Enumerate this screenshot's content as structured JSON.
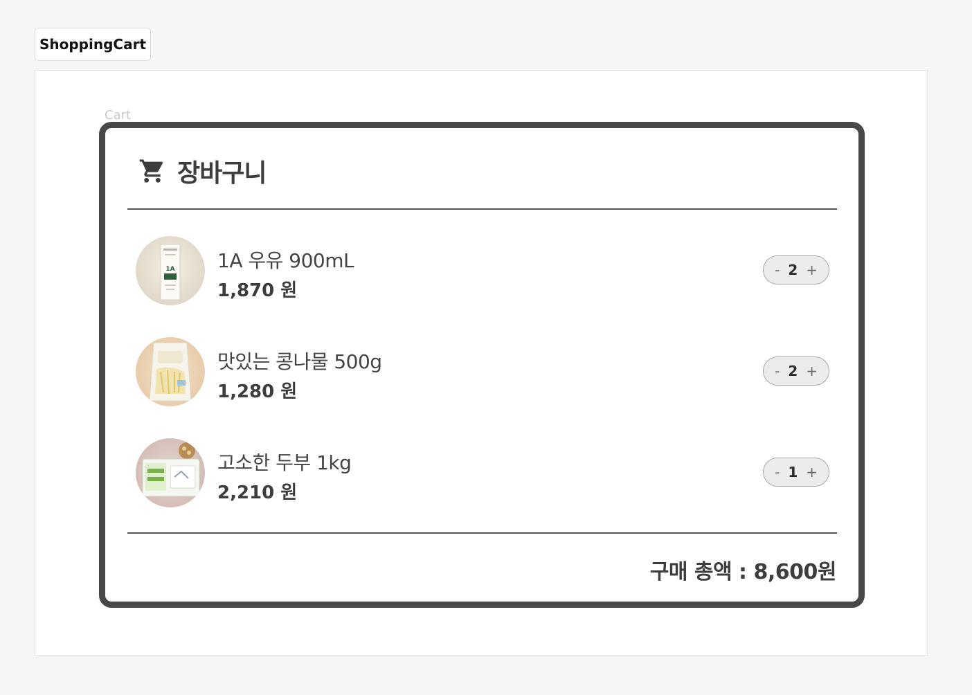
{
  "story": {
    "tab_label": "ShoppingCart"
  },
  "canvas": {
    "caption": "Cart"
  },
  "cart": {
    "title": "장바구니",
    "header_icon": "shopping-cart-icon",
    "items": [
      {
        "name": "1A 우유 900mL",
        "price": "1,870 원",
        "quantity": "2",
        "decrement": "-",
        "increment": "+",
        "image": "milk-carton-photo"
      },
      {
        "name": "맛있는 콩나물 500g",
        "price": "1,280 원",
        "quantity": "2",
        "decrement": "-",
        "increment": "+",
        "image": "bean-sprouts-bag-photo"
      },
      {
        "name": "고소한 두부 1kg",
        "price": "2,210 원",
        "quantity": "1",
        "decrement": "-",
        "increment": "+",
        "image": "tofu-package-photo"
      }
    ],
    "total_label": "구매 총액 : 8,600원"
  },
  "colors": {
    "frame_border": "#484848",
    "stepper_bg": "#ececec",
    "page_bg": "#f5f6f8"
  }
}
